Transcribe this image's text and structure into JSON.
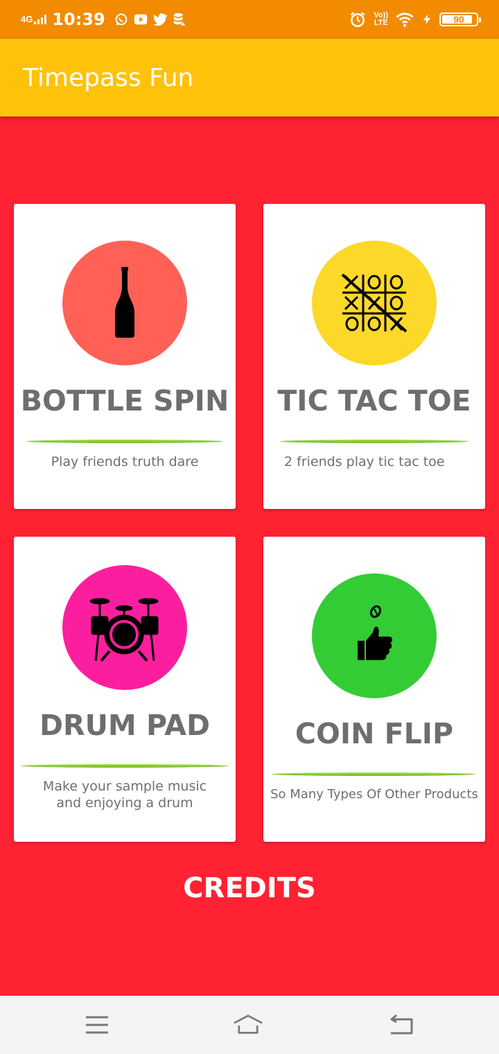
{
  "status_bar": {
    "network": "4G",
    "time": "10:39",
    "notification_icons": [
      "whatsapp-icon",
      "youtube-icon",
      "twitter-icon",
      "data-saver-icon"
    ],
    "volte_label": "Vo))",
    "lte_label": "LTE",
    "battery_level": "90"
  },
  "app": {
    "title": "Timepass Fun"
  },
  "cards": [
    {
      "title": "BOTTLE SPIN",
      "description": "Play friends truth dare",
      "icon": "bottle-icon",
      "circle_color": "#ff6157"
    },
    {
      "title": "TIC TAC TOE",
      "description": "2 friends play tic tac toe",
      "icon": "tic-tac-toe-icon",
      "circle_color": "#fcd829"
    },
    {
      "title": "DRUM PAD",
      "description": "Make your sample music and enjoying a drum",
      "icon": "drum-kit-icon",
      "circle_color": "#fb1f9f"
    },
    {
      "title": "COIN FLIP",
      "description": "So Many Types Of Other Products",
      "icon": "coin-flip-icon",
      "circle_color": "#33cc35"
    }
  ],
  "credits_label": "CREDITS",
  "colors": {
    "status_bar": "#f28b00",
    "app_bar": "#ffc20b",
    "background": "#ff2233",
    "divider": "#8bcf35"
  },
  "nav": {
    "icons": [
      "menu-icon",
      "home-icon",
      "back-icon"
    ]
  }
}
